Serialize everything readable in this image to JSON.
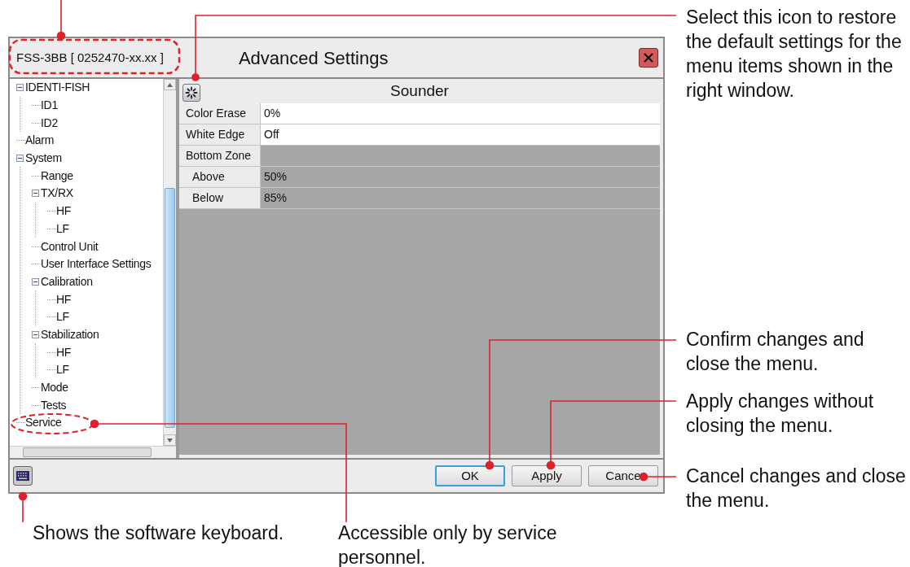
{
  "window": {
    "model_label": "FSS-3BB [ 0252470-xx.xx ]",
    "title": "Advanced Settings"
  },
  "tree": [
    {
      "label": "IDENTI-FISH",
      "expanded": true,
      "children": [
        {
          "label": "ID1"
        },
        {
          "label": "ID2"
        }
      ]
    },
    {
      "label": "Alarm"
    },
    {
      "label": "System",
      "expanded": true,
      "children": [
        {
          "label": "Range"
        },
        {
          "label": "TX/RX",
          "expanded": true,
          "children": [
            {
              "label": "HF"
            },
            {
              "label": "LF"
            }
          ]
        },
        {
          "label": "Control Unit"
        },
        {
          "label": "User Interface Settings"
        },
        {
          "label": "Calibration",
          "expanded": true,
          "children": [
            {
              "label": "HF"
            },
            {
              "label": "LF"
            }
          ]
        },
        {
          "label": "Stabilization",
          "expanded": true,
          "children": [
            {
              "label": "HF"
            },
            {
              "label": "LF"
            }
          ]
        },
        {
          "label": "Mode"
        },
        {
          "label": "Tests"
        }
      ]
    },
    {
      "label": "Service"
    }
  ],
  "panel": {
    "title": "Sounder",
    "rows": [
      {
        "label": "Color Erase",
        "value": "0%",
        "disabled": false
      },
      {
        "label": "White Edge",
        "value": "Off",
        "disabled": false
      },
      {
        "label": "Bottom Zone",
        "disabled": true,
        "children": [
          {
            "label": "Above",
            "value": "50%",
            "disabled": true
          },
          {
            "label": "Below",
            "value": "85%",
            "disabled": true
          }
        ]
      }
    ]
  },
  "buttons": [
    {
      "label": "OK",
      "focused": true
    },
    {
      "label": "Apply",
      "focused": false
    },
    {
      "label": "Cance",
      "focused": false
    }
  ],
  "callouts": [
    {
      "kind": "reset",
      "text": "Select this icon to restore the default settings for the menu items shown in the right window."
    },
    {
      "kind": "ok",
      "text": "Confirm changes and close the menu."
    },
    {
      "kind": "apply",
      "text": "Apply changes without closing the menu."
    },
    {
      "kind": "cancel",
      "text": "Cancel changes and close the menu."
    },
    {
      "kind": "keyboard",
      "text": "Shows the software keyboard."
    },
    {
      "kind": "service",
      "text": "Accessible only by service personnel."
    }
  ]
}
